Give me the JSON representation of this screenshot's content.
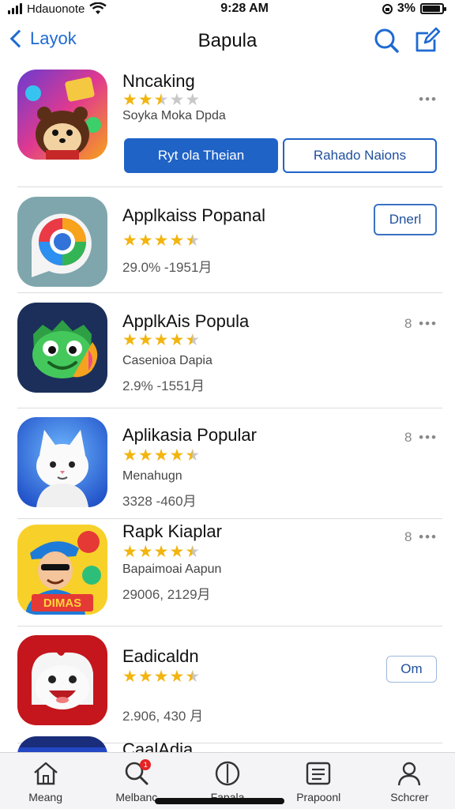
{
  "status_bar": {
    "carrier": "Hdauonote",
    "time": "9:28 AM",
    "battery": "3%",
    "battery_level": 0.9
  },
  "nav": {
    "back_label": "Layok",
    "title": "Bapula"
  },
  "apps": [
    {
      "title": "Nncaking",
      "rating": 2.5,
      "subtitle": "Soyka Moka Dpda",
      "meta": "",
      "action_type": "two_buttons",
      "primary_label": "Ryt ola Theian",
      "secondary_label": "Rahado Naions",
      "more": "•••"
    },
    {
      "title": "Applkaiss Popanal",
      "rating": 4.5,
      "subtitle": "",
      "meta": "29.0% -1951月",
      "action_type": "button",
      "button_label": "Dnerl",
      "more": ""
    },
    {
      "title": "ApplkAis Popula",
      "rating": 4.5,
      "subtitle": "Casenioa Dapia",
      "meta": "2.9% -1551月",
      "action_type": "more",
      "more": "8 •••"
    },
    {
      "title": "Aplikasia Popular",
      "rating": 4.5,
      "subtitle": "Menahugn",
      "meta": "3328 -460月",
      "action_type": "more",
      "more": "8 •••"
    },
    {
      "title": "Rapk Kiaplar",
      "rating": 4.5,
      "subtitle": "Bapaimoai Aapun",
      "meta": "29006, 2129月",
      "action_type": "more",
      "more": "8 •••",
      "icon_text": "DIMAS"
    },
    {
      "title": "Eadicaldn",
      "rating": 4.5,
      "subtitle": "",
      "meta": "2.906, 430 月",
      "action_type": "button_light",
      "button_label": "Om",
      "more": ""
    },
    {
      "title": "CaalAdia",
      "rating": 0,
      "subtitle": "",
      "meta": "",
      "action_type": "none",
      "more": ""
    }
  ],
  "tabs": [
    {
      "label": "Meang",
      "icon": "home-icon"
    },
    {
      "label": "Melbanc",
      "icon": "search-icon",
      "badge": "1"
    },
    {
      "label": "Fapala",
      "icon": "clock-icon"
    },
    {
      "label": "Prapoonl",
      "icon": "list-icon"
    },
    {
      "label": "Schcrer",
      "icon": "person-icon"
    }
  ]
}
